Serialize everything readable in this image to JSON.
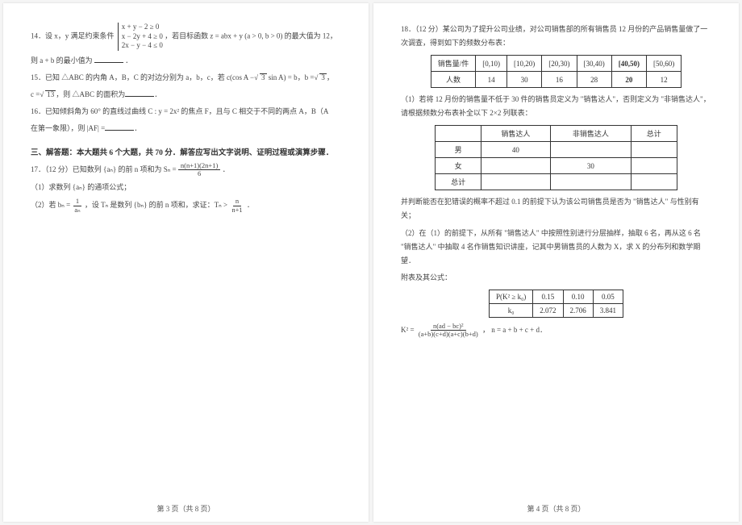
{
  "page_left": {
    "q14": {
      "prefix": "14．设 x，y 满足约束条件",
      "constraints": [
        "x + y − 2 ≥ 0",
        "x − 2y + 4 ≥ 0",
        "2x − y − 4 ≤ 0"
      ],
      "mid": "，若目标函数 z = abx + y (a > 0, b > 0) 的最大值为 12，",
      "line2_pre": "则 a + b 的最小值为",
      "line2_post": "．"
    },
    "q15": {
      "line1_a": "15．已知 △ABC 的内角 A，B，C 的对边分别为 a，b，c，若 c(cos A −",
      "line1_b": " sin A) = b，b =",
      "line1_c": "，",
      "line2_a": "c =",
      "line2_b": "，则 △ABC 的面积为",
      "line2_c": "．",
      "root3": "3",
      "root13": "13"
    },
    "q16": {
      "line1": "16．已知倾斜角为 60° 的直线过曲线 C : y = 2x² 的焦点 F，且与 C 相交于不同的两点 A，B（A",
      "line2_a": "在第一象限），则 |AF| =",
      "line2_b": "．"
    },
    "section_head": "三、解答题：本大题共 6 个大题，共 70 分．解答应写出文字说明、证明过程或演算步骤．",
    "q17": {
      "head_a": "17．（12 分）已知数列 {aₙ} 的前 n 项和为 Sₙ =",
      "frac_num": "n(n+1)(2n+1)",
      "frac_den": "6",
      "head_b": "．",
      "sub1": "（1）求数列 {aₙ} 的通项公式；",
      "sub2_a": "（2）若 bₙ = ",
      "sub2_frac_num": "1",
      "sub2_frac_den": "aₙ",
      "sub2_b": "，设 Tₙ 是数列 {bₙ} 的前 n 项和，求证：Tₙ >",
      "sub2_frac2_num": "n",
      "sub2_frac2_den": "n+1",
      "sub2_c": "．"
    },
    "footer": "第 3 页（共 8 页）"
  },
  "page_right": {
    "q18": {
      "head": "18．（12 分）某公司为了提升公司业绩，对公司销售部的所有销售员 12 月份的产品销售量做了一次调查，得到如下的频数分布表：",
      "table1": {
        "row1_label": "销售量/件",
        "ranges": [
          "[0,10)",
          "[10,20)",
          "[20,30)",
          "[30,40)",
          "[40,50)",
          "[50,60)"
        ],
        "row2_label": "人数",
        "counts": [
          "14",
          "30",
          "16",
          "28",
          "20",
          "12"
        ]
      },
      "sub1": "（1）若将 12 月份的销售量不低于 30 件的销售员定义为 \"销售达人\"，否则定义为 \"非销售达人\"，请根据频数分布表补全以下 2×2 列联表：",
      "table2": {
        "headers": [
          "",
          "销售达人",
          "非销售达人",
          "总计"
        ],
        "rows": [
          [
            "男",
            "40",
            "",
            ""
          ],
          [
            "女",
            "",
            "30",
            ""
          ],
          [
            "总计",
            "",
            "",
            ""
          ]
        ]
      },
      "sub1b": "并判断能否在犯错误的概率不超过 0.1 的前提下认为该公司销售员是否为 \"销售达人\" 与性别有关；",
      "sub2": "（2）在（1）的前提下，从所有 \"销售达人\" 中按照性别进行分层抽样，抽取 6 名，再从这 6 名 \"销售达人\" 中抽取 4 名作销售知识讲座，记其中男销售员的人数为 X，求 X 的分布列和数学期望．",
      "appendix_label": "附表及其公式：",
      "table3": {
        "row1_label": "P(K² ≥ k₀)",
        "vals1": [
          "0.15",
          "0.10",
          "0.05"
        ],
        "row2_label": "k₀",
        "vals2": [
          "2.072",
          "2.706",
          "3.841"
        ]
      },
      "formula_a": "K² = ",
      "formula_num": "n(ad − bc)²",
      "formula_den": "(a+b)(c+d)(a+c)(b+d)",
      "formula_b": "，  n = a + b + c + d．"
    },
    "footer": "第 4 页（共 8 页）"
  }
}
